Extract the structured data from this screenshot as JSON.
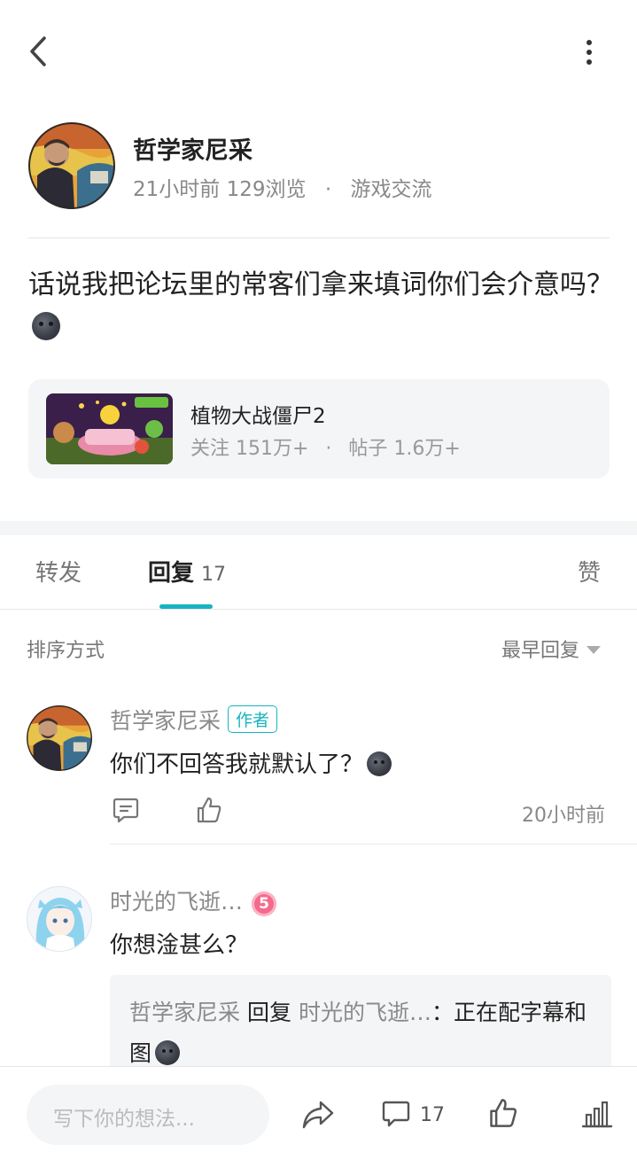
{
  "post": {
    "author": "哲学家尼采",
    "time": "21小时前",
    "views": "129浏览",
    "separator": "·",
    "category": "游戏交流",
    "text": "话说我把论坛里的常客们拿来填词你们会介意吗？"
  },
  "game_card": {
    "title": "植物大战僵尸2",
    "followers": "关注 151万+",
    "separator": "·",
    "posts": "帖子 1.6万+"
  },
  "tabs": {
    "repost": "转发",
    "reply": "回复",
    "reply_count": "17",
    "like": "赞"
  },
  "sort": {
    "label": "排序方式",
    "value": "最早回复"
  },
  "comments": [
    {
      "name": "哲学家尼采",
      "tag": "作者",
      "text": "你们不回答我就默认了？",
      "time": "20小时前"
    },
    {
      "name": "时光的飞逝…",
      "level": "5",
      "text": "你想淦甚么？",
      "quote": {
        "from": "哲学家尼采",
        "verb": "回复",
        "to": "时光的飞逝…",
        "colon": "：",
        "text": "正在配字幕和图"
      }
    }
  ],
  "bottom": {
    "input_placeholder": "写下你的想法...",
    "comment_count": "17"
  },
  "icons": {
    "back": "chevron-left-icon",
    "more": "more-vertical-icon",
    "emoji": "dark-moon-face-emoji",
    "comment": "comment-icon",
    "like": "thumbs-up-icon",
    "share": "share-icon",
    "stats": "bar-chart-icon"
  },
  "colors": {
    "accent": "#18b4c0",
    "level_badge": "#f46a8e",
    "card_bg": "#f4f5f7"
  }
}
